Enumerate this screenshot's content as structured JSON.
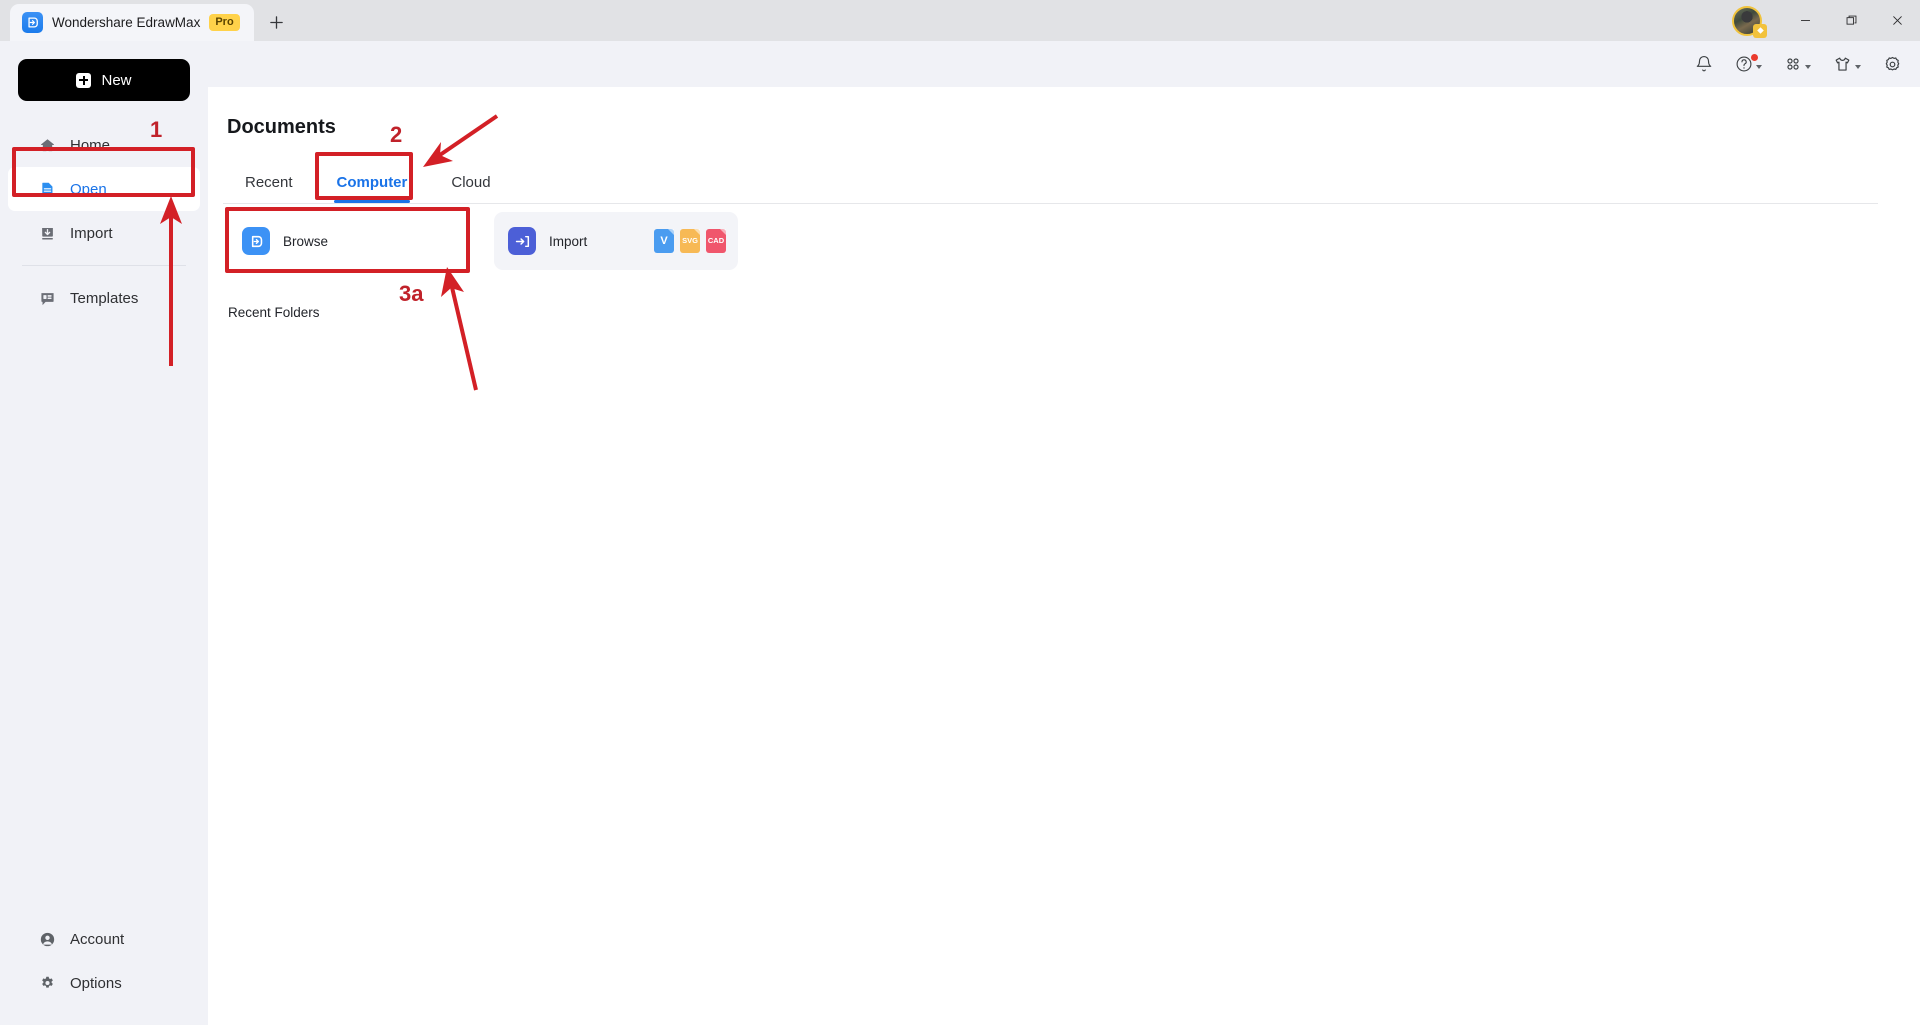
{
  "window": {
    "tab_title": "Wondershare EdrawMax",
    "pro_badge": "Pro",
    "new_tab_tooltip": "+",
    "logo_icon": "edrawmax-logo-icon",
    "avatar_icon": "user-avatar",
    "avatar_badge_icon": "premium-crown-icon",
    "minimize_icon": "minimize-icon",
    "maximize_icon": "maximize-icon",
    "close_icon": "close-icon"
  },
  "utility_bar": {
    "items": [
      {
        "name": "notification-bell-icon",
        "label": "",
        "has_caret": false,
        "has_dot": false
      },
      {
        "name": "help-icon",
        "label": "",
        "has_caret": true,
        "has_dot": true
      },
      {
        "name": "apps-grid-icon",
        "label": "",
        "has_caret": true,
        "has_dot": false
      },
      {
        "name": "theme-shirt-icon",
        "label": "",
        "has_caret": true,
        "has_dot": false
      },
      {
        "name": "settings-gear-icon",
        "label": "",
        "has_caret": false,
        "has_dot": false
      }
    ]
  },
  "sidebar": {
    "new_button": "New",
    "items": [
      {
        "label": "Home",
        "icon": "home-icon",
        "active": false
      },
      {
        "label": "Open",
        "icon": "open-document-icon",
        "active": true
      },
      {
        "label": "Import",
        "icon": "import-icon",
        "active": false
      },
      {
        "label": "Templates",
        "icon": "templates-icon",
        "active": false
      }
    ],
    "bottom_items": [
      {
        "label": "Account",
        "icon": "account-icon"
      },
      {
        "label": "Options",
        "icon": "options-gear-icon"
      }
    ]
  },
  "main": {
    "title": "Documents",
    "tabs": [
      {
        "label": "Recent",
        "active": false
      },
      {
        "label": "Computer",
        "active": true
      },
      {
        "label": "Cloud",
        "active": false
      }
    ],
    "cards": [
      {
        "label": "Browse",
        "icon": "browse-icon"
      },
      {
        "label": "Import",
        "icon": "import-arrow-icon"
      }
    ],
    "format_badges": [
      {
        "label": "V",
        "color": "#4a9cf0"
      },
      {
        "label": "SVG",
        "color": "#f7b955"
      },
      {
        "label": "CAD",
        "color": "#f0566c"
      }
    ],
    "recent_folders_label": "Recent Folders"
  },
  "annotations": {
    "color": "#d32026",
    "steps": [
      {
        "id": "1",
        "target": "sidebar-item-open"
      },
      {
        "id": "2",
        "target": "tab-computer"
      },
      {
        "id": "3a",
        "target": "browse-card"
      }
    ]
  },
  "colors": {
    "accent_blue": "#1a73e8",
    "sidebar_bg": "#f1f2f7",
    "titlebar_bg": "#e1e2e5",
    "annotation_red": "#d32026",
    "pro_badge_bg": "#ffd24a"
  }
}
